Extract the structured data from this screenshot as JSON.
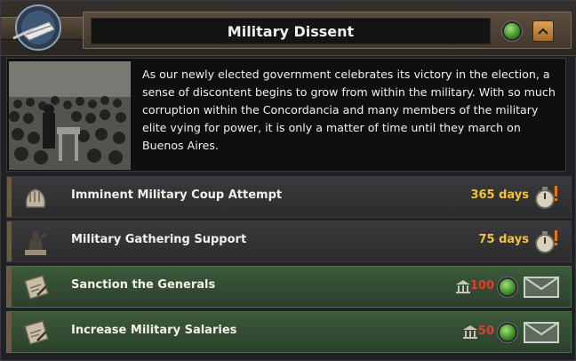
{
  "header": {
    "title": "Military Dissent"
  },
  "description": {
    "text": "As our newly elected government celebrates its victory in the election, a sense of discontent begins to grow from within the military. With so much corruption within the Concordancia and many members of the military elite vying for power, it is only a matter of time until they march on Buenos Aires."
  },
  "missions": [
    {
      "label": "Imminent Military Coup Attempt",
      "days": "365 days"
    },
    {
      "label": "Military Gathering Support",
      "days": "75 days"
    }
  ],
  "decisions": [
    {
      "label": "Sanction the Generals",
      "cost": "100"
    },
    {
      "label": "Increase Military Salaries",
      "cost": "50"
    }
  ],
  "colors": {
    "days": "#f0c43a",
    "cost": "#e43b2b",
    "available": "#3f8a26"
  }
}
